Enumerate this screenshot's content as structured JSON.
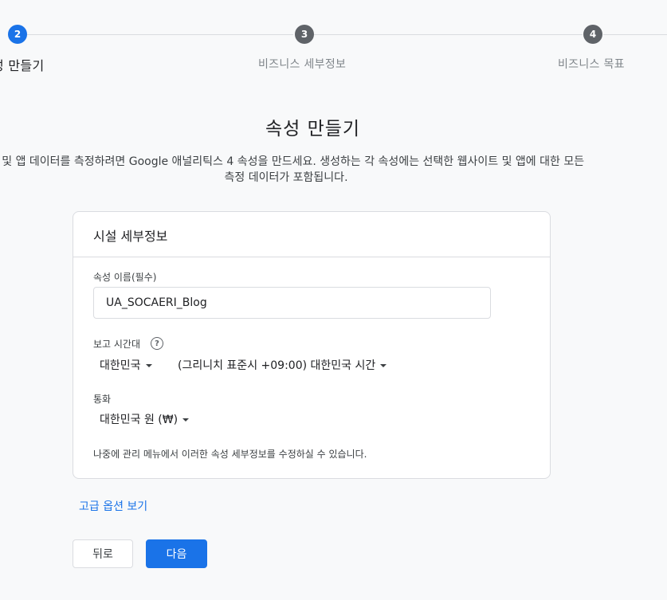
{
  "stepper": {
    "steps": [
      {
        "number": "2",
        "label": "성 만들기",
        "state": "active"
      },
      {
        "number": "3",
        "label": "비즈니스 세부정보",
        "state": "inactive"
      },
      {
        "number": "4",
        "label": "비즈니스 목표",
        "state": "inactive"
      }
    ]
  },
  "header": {
    "title": "속성 만들기",
    "description_line1": "웹 및 앱 데이터를 측정하려면 Google 애널리틱스 4 속성을 만드세요. 생성하는 각 속성에는 선택한 웹사이트 및 앱에 대한 모든",
    "description_line2": "측정 데이터가 포함됩니다."
  },
  "card": {
    "title": "시설 세부정보",
    "property_name": {
      "label": "속성 이름(필수)",
      "value": "UA_SOCAERI_Blog"
    },
    "timezone": {
      "label": "보고 시간대",
      "help_icon": "help-circle-icon",
      "country": "대한민국",
      "zone": "(그리니치 표준시 +09:00) 대한민국 시간"
    },
    "currency": {
      "label": "통화",
      "value": "대한민국 원 (₩)"
    },
    "helper_text": "나중에 관리 메뉴에서 이러한 속성 세부정보를 수정하실 수 있습니다."
  },
  "advanced_link": "고급 옵션 보기",
  "buttons": {
    "back": "뒤로",
    "next": "다음"
  },
  "colors": {
    "accent": "#1a73e8",
    "step_inactive": "#5f6368",
    "background": "#f8f9fa",
    "border": "#dadce0"
  }
}
